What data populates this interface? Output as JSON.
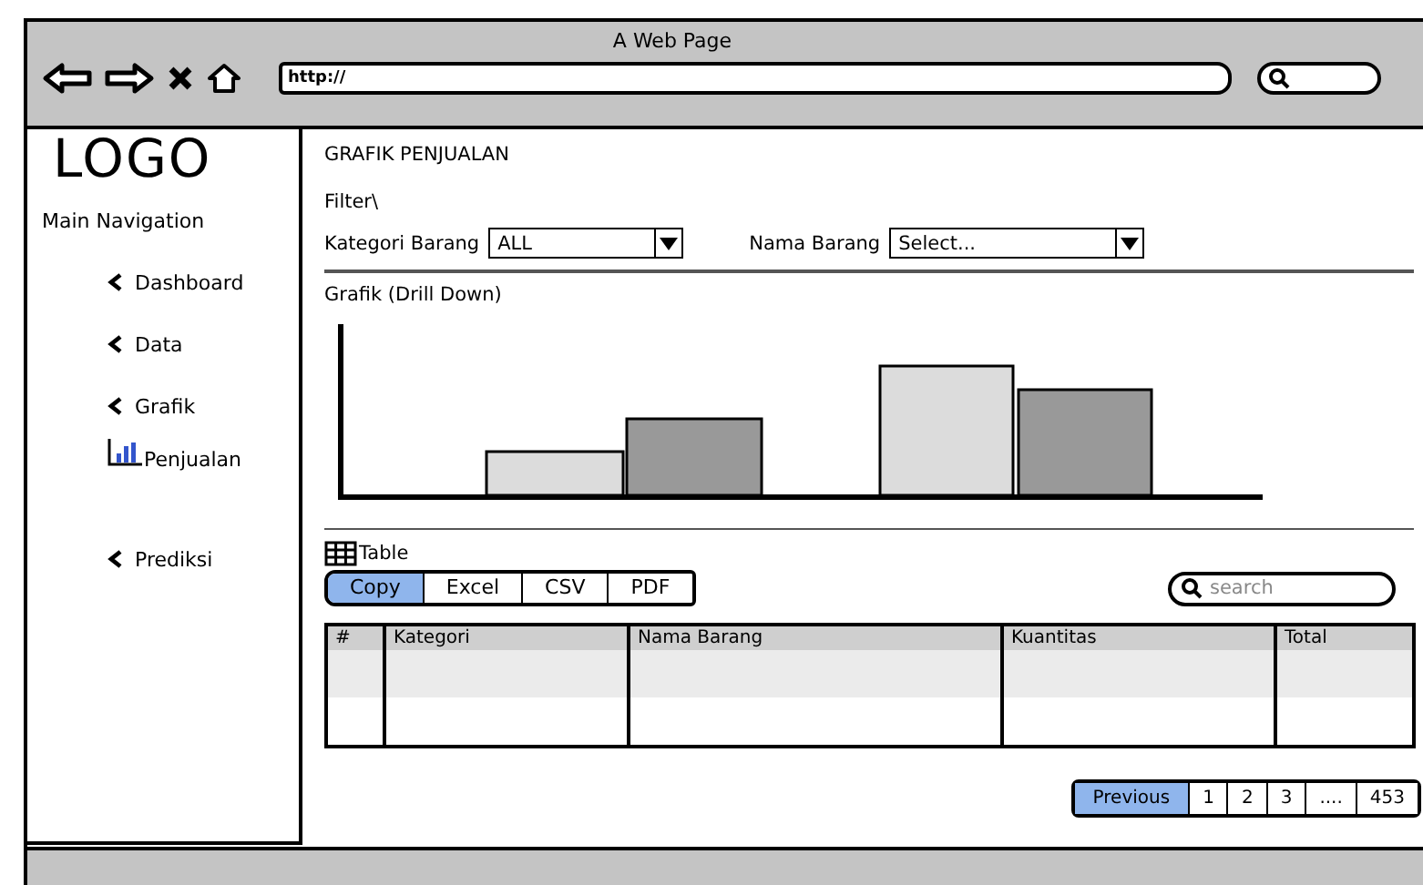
{
  "window": {
    "title": "A Web Page",
    "url": "http://"
  },
  "logo": "LOGO",
  "sidebar": {
    "heading": "Main Navigation",
    "items": [
      {
        "label": "Dashboard",
        "kind": "chevron"
      },
      {
        "label": "Data",
        "kind": "chevron"
      },
      {
        "label": "Grafik",
        "kind": "chevron"
      },
      {
        "label": "Penjualan",
        "kind": "chart"
      },
      {
        "label": "Prediksi",
        "kind": "chevron"
      }
    ]
  },
  "page_title": "GRAFIK PENJUALAN",
  "filter": {
    "label": "Filter\\",
    "fields": [
      {
        "label": "Kategori Barang",
        "value": "ALL"
      },
      {
        "label": "Nama Barang",
        "value": "Select..."
      }
    ]
  },
  "chart_section": {
    "title": "Grafik (Drill Down)"
  },
  "table_section": {
    "title": "Table",
    "export_buttons": [
      {
        "label": "Copy",
        "selected": true
      },
      {
        "label": "Excel",
        "selected": false
      },
      {
        "label": "CSV",
        "selected": false
      },
      {
        "label": "PDF",
        "selected": false
      }
    ],
    "search": {
      "placeholder": "search"
    },
    "columns": [
      "#",
      "Kategori",
      "Nama Barang",
      "Kuantitas",
      "Total"
    ],
    "pagination": [
      {
        "label": "Previous",
        "selected": true
      },
      {
        "label": "1",
        "selected": false
      },
      {
        "label": "2",
        "selected": false
      },
      {
        "label": "3",
        "selected": false
      },
      {
        "label": "....",
        "selected": false
      },
      {
        "label": "453",
        "selected": false
      }
    ]
  }
}
